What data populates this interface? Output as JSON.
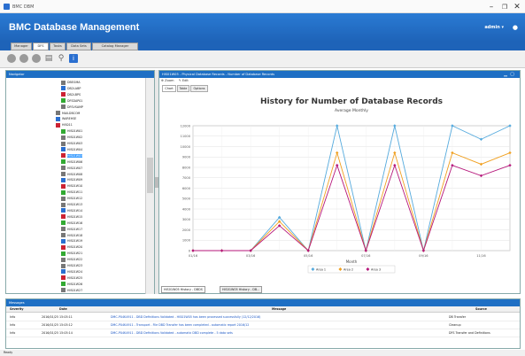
{
  "window": {
    "title": "BMC DBM"
  },
  "app": {
    "title": "BMC Database Management",
    "user": "admin ▾"
  },
  "main_tabs": [
    "Manager",
    "DFS",
    "Tasks",
    "Data Sets",
    "Catalog Manager"
  ],
  "nav": {
    "header": "Navigator",
    "items": [
      {
        "label": "DBEGMA",
        "indent": 1
      },
      {
        "label": "DB2LABP",
        "indent": 1
      },
      {
        "label": "DB2LBPS",
        "indent": 1
      },
      {
        "label": "DFSDAP01",
        "indent": 1
      },
      {
        "label": "DFSVSAMP",
        "indent": 1
      },
      {
        "label": "MAILDBCOM",
        "indent": 0
      },
      {
        "label": "WAREHSE",
        "indent": 0
      },
      {
        "label": "HIS011",
        "indent": 0
      },
      {
        "label": "HIS01W01",
        "indent": 1
      },
      {
        "label": "HIS01W02",
        "indent": 1
      },
      {
        "label": "HIS01W03",
        "indent": 1
      },
      {
        "label": "HIS01W04",
        "indent": 1
      },
      {
        "label": "HIS01W05",
        "indent": 1,
        "selected": true
      },
      {
        "label": "HIS01W06",
        "indent": 1
      },
      {
        "label": "HIS01W07",
        "indent": 1
      },
      {
        "label": "HIS01W08",
        "indent": 1
      },
      {
        "label": "HIS01W09",
        "indent": 1
      },
      {
        "label": "HIS01W10",
        "indent": 1
      },
      {
        "label": "HIS01W11",
        "indent": 1
      },
      {
        "label": "HIS01W12",
        "indent": 1
      },
      {
        "label": "HIS01W13",
        "indent": 1
      },
      {
        "label": "HIS01W14",
        "indent": 1
      },
      {
        "label": "HIS01W15",
        "indent": 1
      },
      {
        "label": "HIS01W16",
        "indent": 1
      },
      {
        "label": "HIS01W17",
        "indent": 1
      },
      {
        "label": "HIS01W18",
        "indent": 1
      },
      {
        "label": "HIS01W19",
        "indent": 1
      },
      {
        "label": "HIS01W20",
        "indent": 1
      },
      {
        "label": "HIS01W21",
        "indent": 1
      },
      {
        "label": "HIS01W22",
        "indent": 1
      },
      {
        "label": "HIS01W23",
        "indent": 1
      },
      {
        "label": "HIS01W24",
        "indent": 1
      },
      {
        "label": "HIS01W25",
        "indent": 1
      },
      {
        "label": "HIS01W26",
        "indent": 1
      },
      {
        "label": "HIS01W27",
        "indent": 1
      }
    ]
  },
  "chart_panel": {
    "header": "HIS01W05 - Physical Database Records - Number of Database Records",
    "toolbar": {
      "zoom": "Zoom",
      "edit": "Edit"
    },
    "subtabs": [
      "Chart",
      "Table",
      "Options"
    ],
    "bottom_tabs": [
      "HIS01W05 History - DBDS",
      "HIS01W05 History - DB..."
    ]
  },
  "chart_data": {
    "type": "line",
    "title": "History for Number of Database Records",
    "subtitle": "Average Monthly",
    "xlabel": "Month",
    "ylabel": "",
    "x": [
      "01/16",
      "02/16",
      "03/16",
      "04/16",
      "05/16",
      "06/16",
      "07/16",
      "08/16",
      "09/16",
      "10/16",
      "11/16",
      "12/16"
    ],
    "x_tick_labels": [
      "01/16",
      "03/16",
      "05/16",
      "07/16",
      "09/16",
      "11/16"
    ],
    "ylim": [
      0,
      12000
    ],
    "yticks": [
      0,
      1000,
      2000,
      3000,
      4000,
      5000,
      6000,
      7000,
      8000,
      9000,
      10000,
      11000,
      12000
    ],
    "grid": true,
    "legend": "bottom",
    "series": [
      {
        "name": "Area 1",
        "color": "#55aadd",
        "values": [
          0,
          0,
          0,
          3200,
          0,
          12000,
          0,
          12000,
          0,
          12000,
          10700,
          12000
        ]
      },
      {
        "name": "Area 2",
        "color": "#f0a020",
        "values": [
          0,
          0,
          0,
          2800,
          0,
          9400,
          0,
          9400,
          0,
          9400,
          8300,
          9400
        ]
      },
      {
        "name": "Area 3",
        "color": "#b5167a",
        "values": [
          0,
          0,
          0,
          2400,
          0,
          8200,
          0,
          8200,
          0,
          8200,
          7200,
          8200
        ]
      }
    ]
  },
  "messages": {
    "header": "Messages",
    "columns": [
      "Severity",
      "Date",
      "Message",
      "Source"
    ],
    "rows": [
      {
        "severity": "Info",
        "date": "2016/01/25 15:05:11",
        "message": "DMC-P04K4911 - DBD Definitions Validated - HIS01W05 has been processed successfully (12/12/2016)",
        "source": "DB Transfer"
      },
      {
        "severity": "Info",
        "date": "2016/01/25 15:05:12",
        "message": "DMC-P04K4911 - Transport - File DBD Transfer has been completed - automatic report 2016/12",
        "source": "Cleanup"
      },
      {
        "severity": "Info",
        "date": "2016/01/25 15:05:14",
        "message": "DMC-P04K4911 - DBD Definitions Validated - automatic DBD complete - 5 data sets",
        "source": "DFS Transfer and Definitions"
      }
    ]
  },
  "status": {
    "text": "Ready"
  }
}
